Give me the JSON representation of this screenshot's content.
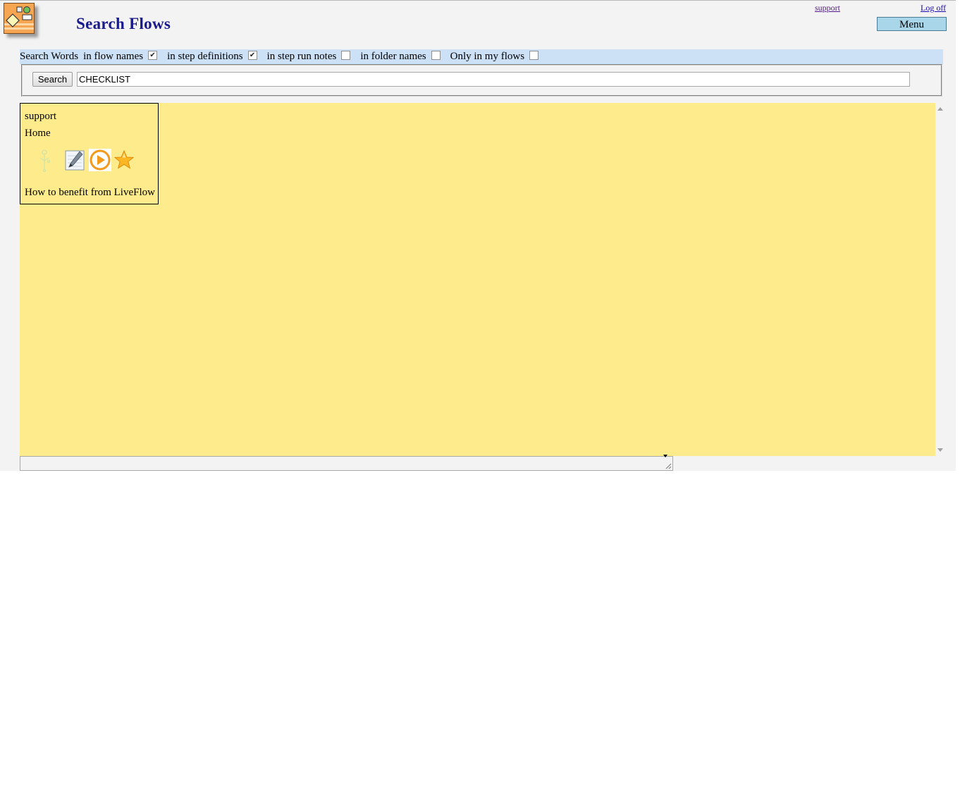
{
  "header": {
    "title": "Search Flows",
    "links": {
      "support": "support",
      "logoff": "Log off"
    },
    "menu_label": "Menu"
  },
  "search_options": {
    "label_prefix": "Search Words",
    "options": [
      {
        "label": "in flow names",
        "checked": true
      },
      {
        "label": "in step definitions",
        "checked": true
      },
      {
        "label": "in step run notes",
        "checked": false
      },
      {
        "label": "in folder names",
        "checked": false
      },
      {
        "label": "Only in my flows",
        "checked": false
      }
    ]
  },
  "search": {
    "button_label": "Search",
    "query": "CHECKLIST"
  },
  "results": [
    {
      "owner": "support",
      "folder": "Home",
      "title": "How to benefit from LiveFlow",
      "icons": [
        "flowchart-icon",
        "edit-notepad-icon",
        "play-run-icon",
        "star-favorite-icon"
      ]
    }
  ],
  "colors": {
    "results_background": "#feec8c",
    "options_bar": "#cce0f6",
    "title_blue": "#1a1a8a",
    "menu_button": "#a9d6e8"
  }
}
